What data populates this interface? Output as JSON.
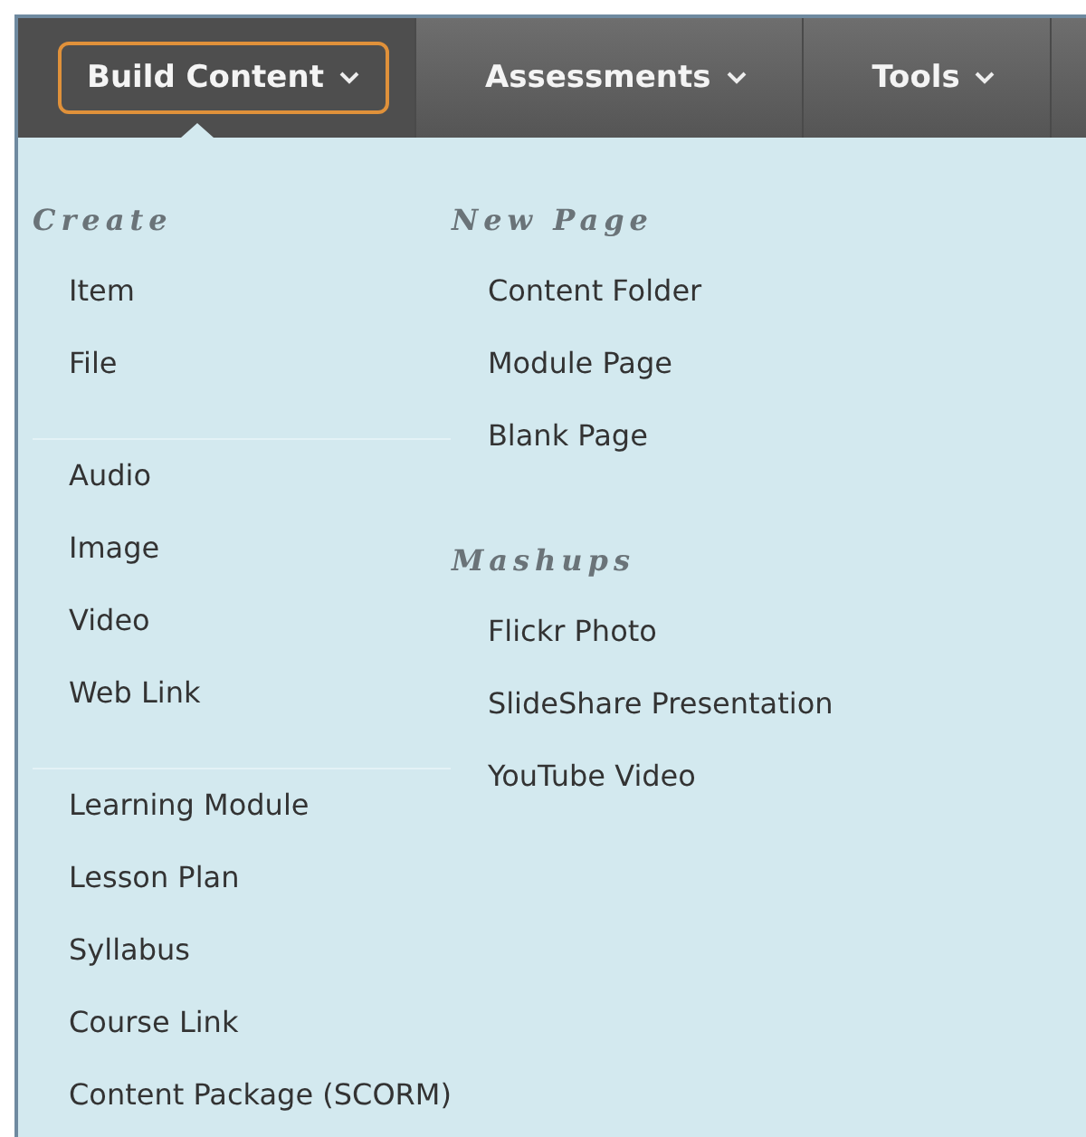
{
  "nav_tabs": [
    {
      "label": "Build Content",
      "selected": true
    },
    {
      "label": "Assessments",
      "selected": false
    },
    {
      "label": "Tools",
      "selected": false
    }
  ],
  "menu": {
    "columns": [
      {
        "sections": [
          {
            "heading": "Create",
            "groups": [
              [
                "Item",
                "File"
              ],
              [
                "Audio",
                "Image",
                "Video",
                "Web Link"
              ],
              [
                "Learning Module",
                "Lesson Plan",
                "Syllabus",
                "Course Link",
                "Content Package (SCORM)"
              ]
            ]
          }
        ]
      },
      {
        "sections": [
          {
            "heading": "New Page",
            "groups": [
              [
                "Content Folder",
                "Module Page",
                "Blank Page"
              ]
            ]
          },
          {
            "heading": "Mashups",
            "groups": [
              [
                "Flickr Photo",
                "SlideShare Presentation",
                "YouTube Video"
              ]
            ]
          }
        ]
      }
    ]
  }
}
